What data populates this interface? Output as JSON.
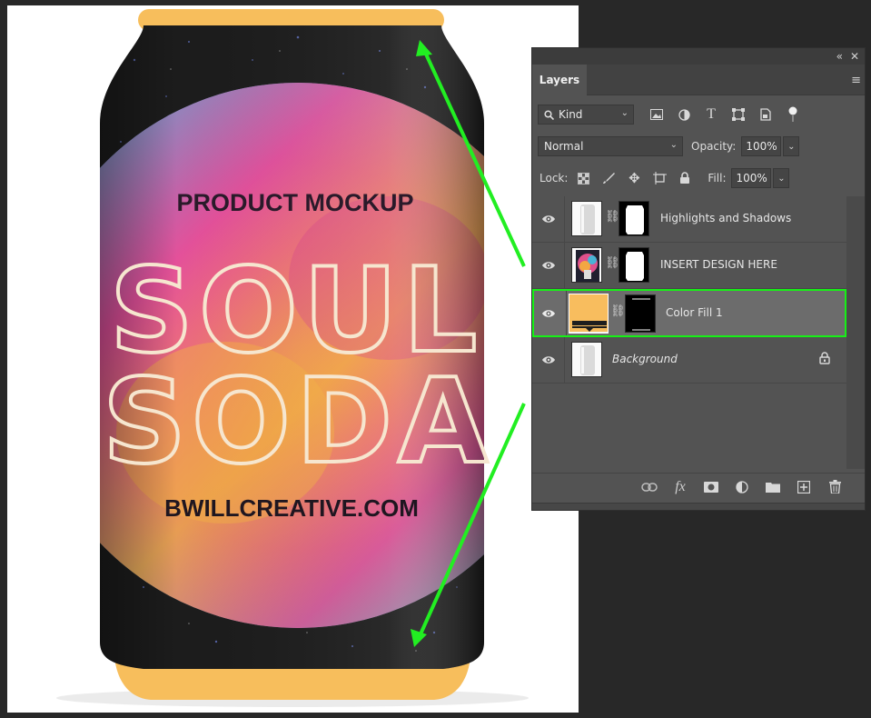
{
  "canvas": {
    "can_texts": {
      "header": "PRODUCT MOCKUP",
      "line1": "SOUL",
      "line2": "SODA",
      "footer": "BWILLCREATIVE.COM"
    },
    "colors": {
      "can_body": "#1c1c1c",
      "can_rim": "#f7be5c",
      "highlight_arrow": "#22ee22"
    }
  },
  "panel": {
    "tab_label": "Layers",
    "collapse_icon": "double-chevron-left-icon",
    "close_icon": "close-icon",
    "menu_icon": "hamburger-icon",
    "filter": {
      "kind_label": "Kind",
      "icons": [
        "image-filter-icon",
        "adjustment-filter-icon",
        "type-filter-icon",
        "shape-filter-icon",
        "smart-object-filter-icon",
        "filter-toggle-icon"
      ]
    },
    "blend": {
      "mode": "Normal",
      "opacity_label": "Opacity:",
      "opacity_value": "100%"
    },
    "lock": {
      "label": "Lock:",
      "icons": [
        "lock-transparent-icon",
        "lock-image-icon",
        "lock-position-icon",
        "lock-artboard-icon",
        "lock-all-icon"
      ],
      "fill_label": "Fill:",
      "fill_value": "100%"
    },
    "layers": [
      {
        "name": "Highlights and Shadows",
        "visible": true,
        "selected": false,
        "has_mask": true,
        "italic": false,
        "locked": false
      },
      {
        "name": "INSERT DESIGN HERE",
        "visible": true,
        "selected": false,
        "has_mask": true,
        "italic": false,
        "locked": false
      },
      {
        "name": "Color Fill 1",
        "visible": true,
        "selected": true,
        "has_mask": true,
        "italic": false,
        "locked": false,
        "fill_color": "#f8bd5e"
      },
      {
        "name": "Background",
        "visible": true,
        "selected": false,
        "has_mask": false,
        "italic": true,
        "locked": true
      }
    ],
    "footer_icons": [
      "link-layers-icon",
      "fx-icon",
      "add-mask-icon",
      "new-adjustment-icon",
      "new-group-icon",
      "new-layer-icon",
      "delete-layer-icon"
    ],
    "footer_fx_label": "fx"
  }
}
